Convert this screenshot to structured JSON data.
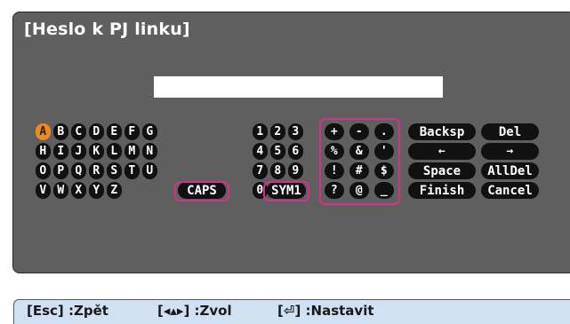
{
  "dialog": {
    "title": "[Heslo k PJ linku]",
    "password_value": "",
    "letters": [
      "A",
      "B",
      "C",
      "D",
      "E",
      "F",
      "G",
      "H",
      "I",
      "J",
      "K",
      "L",
      "M",
      "N",
      "O",
      "P",
      "Q",
      "R",
      "S",
      "T",
      "U",
      "V",
      "W",
      "X",
      "Y",
      "Z"
    ],
    "caps_label": "CAPS",
    "digits": [
      "1",
      "2",
      "3",
      "4",
      "5",
      "6",
      "7",
      "8",
      "9",
      "0"
    ],
    "sym_label": "SYM1",
    "symbols": [
      "+",
      "-",
      ".",
      "%",
      "&",
      "'",
      "!",
      "#",
      "$",
      "?",
      "@",
      "_"
    ],
    "backspace_label": "Backsp",
    "delete_label": "Del",
    "left_arrow_icon": "left-arrow-icon",
    "right_arrow_icon": "right-arrow-icon",
    "space_label": "Space",
    "alldel_label": "AllDel",
    "finish_label": "Finish",
    "cancel_label": "Cancel"
  },
  "status_bar": {
    "esc_hint": "[Esc] :Zpět",
    "arrows_hint_prefix": "[",
    "arrows_hint_suffix": "] :Zvol",
    "enter_hint_prefix": "[",
    "enter_hint_suffix": "] :Nastavit"
  },
  "colors": {
    "panel": "#5f5f5f",
    "key": "#111111",
    "selected_key": "#ee8c1a",
    "highlight": "#d4328a",
    "status_bar": "#cfe1f3"
  }
}
